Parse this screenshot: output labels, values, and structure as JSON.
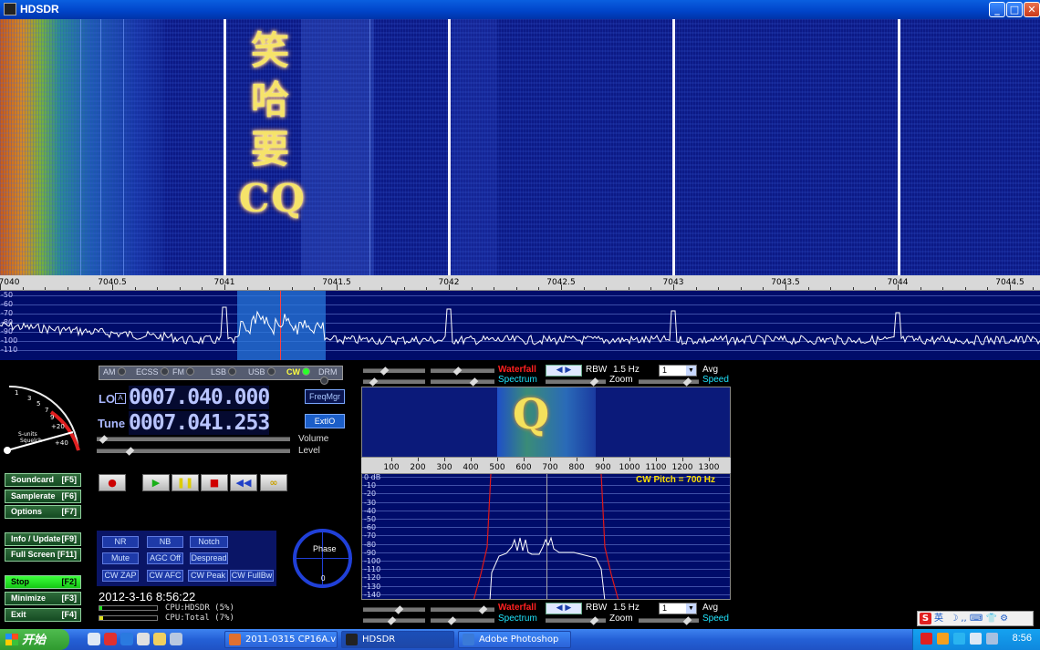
{
  "window": {
    "title": "HDSDR",
    "btn_min": "_",
    "btn_max": "□",
    "btn_close": "✕"
  },
  "waterfall": {
    "glyph_text": "笑哈要CQ"
  },
  "freq_scale": {
    "labels": [
      "7040",
      "7040.5",
      "7041",
      "7041.5",
      "7042",
      "7042.5",
      "7043",
      "7043.5",
      "7044",
      "7044.5"
    ]
  },
  "spectrum": {
    "db_labels": [
      "-50",
      "-60",
      "-70",
      "-80",
      "-90",
      "-100",
      "-110"
    ]
  },
  "modes": [
    {
      "label": "AM",
      "active": false
    },
    {
      "label": "ECSS",
      "active": false
    },
    {
      "label": "FM",
      "active": false
    },
    {
      "label": "LSB",
      "active": false
    },
    {
      "label": "USB",
      "active": false
    },
    {
      "label": "CW",
      "active": true
    },
    {
      "label": "DRM",
      "active": false
    }
  ],
  "tuning": {
    "lo_label": "LO",
    "lo_badge": "A",
    "lo_value": "0007.040.000",
    "tune_label": "Tune",
    "tune_value": "0007.041.253",
    "freqmgr": "FreqMgr",
    "extio": "ExtIO",
    "volume_label": "Volume",
    "level_label": "Level",
    "volume_level": 0.02,
    "level_level": 0.16
  },
  "smeter": {
    "scale_labels": [
      "1",
      "3",
      "5",
      "7",
      "9",
      "+20",
      "+40"
    ],
    "caption": "S-units",
    "squelch": "Squelch"
  },
  "side_buttons": [
    {
      "label": "Soundcard",
      "key": "[F5]"
    },
    {
      "label": "Samplerate",
      "key": "[F6]"
    },
    {
      "label": "Options",
      "key": "[F7]"
    },
    {
      "label": "Info / Update",
      "key": "[F9]"
    },
    {
      "label": "Full Screen",
      "key": "[F11]"
    },
    {
      "label": "Stop",
      "key": "[F2]"
    },
    {
      "label": "Minimize",
      "key": "[F3]"
    },
    {
      "label": "Exit",
      "key": "[F4]"
    }
  ],
  "transport": [
    "●",
    "▶",
    "❚❚",
    "■",
    "◀◀",
    "∞"
  ],
  "dsp": {
    "row1": [
      "NR",
      "NB",
      "Notch"
    ],
    "row2": [
      "Mute",
      "AGC Off",
      "Despread"
    ],
    "row3": [
      "CW ZAP",
      "CW AFC",
      "CW Peak",
      "CW FullBw"
    ]
  },
  "phase": {
    "label": "Phase",
    "zero": "0"
  },
  "status": {
    "datetime": "2012-3-16 8:56:22",
    "cpu_hdsdr": "CPU:HDSDR (5%)",
    "cpu_total": "CPU:Total (7%)",
    "cpu_hdsdr_level": 0.05,
    "cpu_total_level": 0.07
  },
  "audio_top": {
    "waterfall": "Waterfall",
    "spectrum": "Spectrum",
    "rbw_label": "RBW",
    "rbw_value": "1.5 Hz",
    "avg_value": "1",
    "avg_label": "Avg",
    "zoom_label": "Zoom",
    "speed_label": "Speed"
  },
  "audio_bottom": {
    "waterfall": "Waterfall",
    "spectrum": "Spectrum",
    "rbw_label": "RBW",
    "rbw_value": "1.5 Hz",
    "avg_value": "1",
    "avg_label": "Avg",
    "zoom_label": "Zoom",
    "speed_label": "Speed"
  },
  "audio_scale": {
    "labels": [
      "100",
      "200",
      "300",
      "400",
      "500",
      "600",
      "700",
      "800",
      "900",
      "1000",
      "1100",
      "1200",
      "1300"
    ]
  },
  "audio_spectrum": {
    "pitch": "CW Pitch = 700 Hz",
    "db_labels": [
      "0 dB",
      "-10",
      "-20",
      "-30",
      "-40",
      "-50",
      "-60",
      "-70",
      "-80",
      "-90",
      "-100",
      "-110",
      "-120",
      "-130",
      "-140"
    ]
  },
  "ime": {
    "label": "英",
    "icons": "☽ ,,  ⌨ 👕 ⚙"
  },
  "taskbar": {
    "start": "开始",
    "tasks": [
      {
        "label": "2011-0315 CP16A.vi",
        "active": false
      },
      {
        "label": "HDSDR",
        "active": true
      },
      {
        "label": "Adobe Photoshop",
        "active": false
      }
    ],
    "clock": "8:56"
  }
}
